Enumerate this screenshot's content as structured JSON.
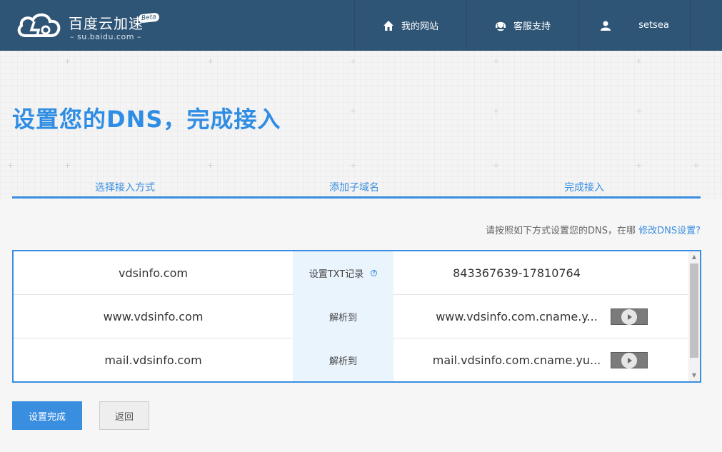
{
  "header": {
    "logo_title": "百度云加速",
    "logo_sub": "– su.baidu.com –",
    "logo_badge": "Beta",
    "nav": [
      {
        "label": "我的网站",
        "icon": "home-icon"
      },
      {
        "label": "客服支持",
        "icon": "headset-icon"
      },
      {
        "label": "setsea",
        "icon": "user-icon"
      }
    ]
  },
  "page": {
    "title": "设置您的DNS，完成接入"
  },
  "steps": [
    "选择接入方式",
    "添加子域名",
    "完成接入"
  ],
  "instruction": {
    "text": "请按照如下方式设置您的DNS，在哪 ",
    "link": "修改DNS设置?"
  },
  "records": [
    {
      "domain": "vdsinfo.com",
      "type": "设置TXT记录",
      "value": "843367639-17810764",
      "has_help": true,
      "has_copy": false
    },
    {
      "domain": "www.vdsinfo.com",
      "type": "解析到",
      "value": "www.vdsinfo.com.cname.y...",
      "has_help": false,
      "has_copy": true
    },
    {
      "domain": "mail.vdsinfo.com",
      "type": "解析到",
      "value": "mail.vdsinfo.com.cname.yu...",
      "has_help": false,
      "has_copy": true
    }
  ],
  "buttons": {
    "done": "设置完成",
    "back": "返回"
  },
  "colors": {
    "header_bg": "#2f5576",
    "accent": "#3a8ee0",
    "type_cell_bg": "#eaf4fd"
  }
}
